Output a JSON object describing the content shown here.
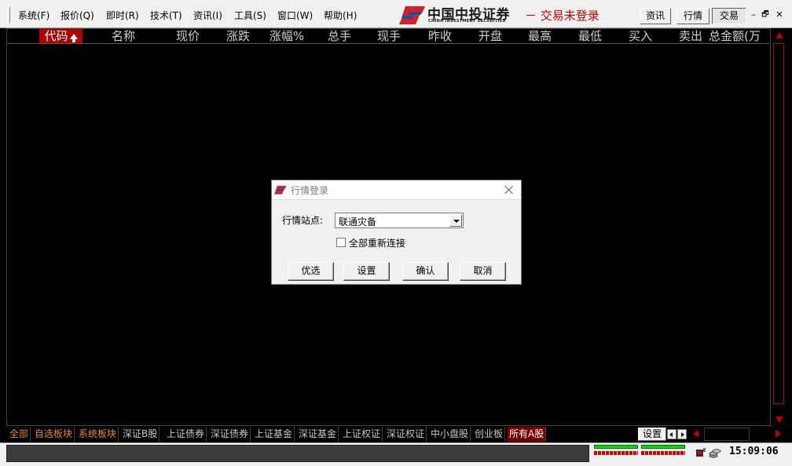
{
  "menu": [
    {
      "id": "system",
      "label": "系统(F)"
    },
    {
      "id": "quote",
      "label": "报价(Q)"
    },
    {
      "id": "realtime",
      "label": "即时(R)"
    },
    {
      "id": "technical",
      "label": "技术(T)"
    },
    {
      "id": "info",
      "label": "资讯(I)"
    },
    {
      "id": "tools",
      "label": "工具(S)"
    },
    {
      "id": "window",
      "label": "窗口(W)"
    },
    {
      "id": "help",
      "label": "帮助(H)"
    }
  ],
  "brand": {
    "name_cn": "中国中投证券",
    "name_en": "CHINA INVESTMENT SECURITIES",
    "accent_blue": "#1a4fa0",
    "accent_red": "#d81e1e"
  },
  "trade_status": "－ 交易未登录",
  "top_buttons": {
    "info": "资讯",
    "quotes": "行情",
    "trade": "交易"
  },
  "window_controls": {
    "minimize": "–",
    "restore": "🗗",
    "close": "✕"
  },
  "columns": [
    {
      "key": "code",
      "label": "代码"
    },
    {
      "key": "name",
      "label": "名称"
    },
    {
      "key": "price",
      "label": "现价"
    },
    {
      "key": "change",
      "label": "涨跌"
    },
    {
      "key": "pct",
      "label": "涨幅%"
    },
    {
      "key": "total_vol",
      "label": "总手"
    },
    {
      "key": "cur_vol",
      "label": "现手"
    },
    {
      "key": "prev_close",
      "label": "昨收"
    },
    {
      "key": "open",
      "label": "开盘"
    },
    {
      "key": "high",
      "label": "最高"
    },
    {
      "key": "low",
      "label": "最低"
    },
    {
      "key": "bid",
      "label": "买入"
    },
    {
      "key": "ask",
      "label": "卖出"
    },
    {
      "key": "amount",
      "label": "总金额(万"
    }
  ],
  "sort_column": "code",
  "bottom_tabs": [
    {
      "label": "全部",
      "style": "orange"
    },
    {
      "label": "自选板块",
      "style": "orange"
    },
    {
      "label": "系统板块",
      "style": "orange"
    },
    {
      "label": "深证B股",
      "style": "normal"
    },
    {
      "label": "上证债券",
      "style": "normal"
    },
    {
      "label": "深证债券",
      "style": "normal"
    },
    {
      "label": "上证基金",
      "style": "normal"
    },
    {
      "label": "深证基金",
      "style": "normal"
    },
    {
      "label": "上证权证",
      "style": "normal"
    },
    {
      "label": "深证权证",
      "style": "normal"
    },
    {
      "label": "中小盘股",
      "style": "normal"
    },
    {
      "label": "创业板",
      "style": "normal"
    },
    {
      "label": "所有A股",
      "style": "active"
    }
  ],
  "bottom_settings": "设置",
  "clock": "15:09:06",
  "dialog": {
    "title": "行情登录",
    "station_label": "行情站点:",
    "station_value": "联通灾备",
    "reconnect_label": "全部重新连接",
    "reconnect_checked": false,
    "buttons": {
      "preferred": "优选",
      "settings": "设置",
      "confirm": "确认",
      "cancel": "取消"
    }
  }
}
